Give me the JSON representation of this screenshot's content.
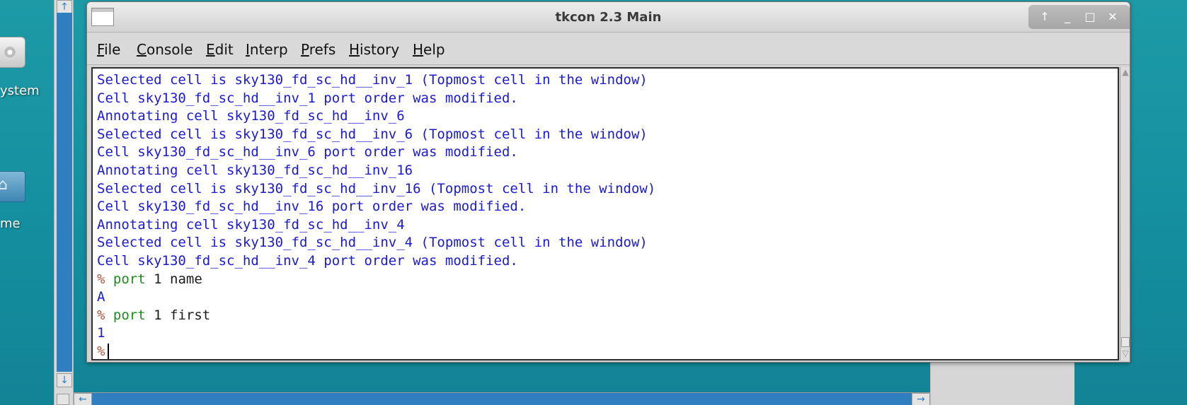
{
  "desktop": {
    "icons": [
      {
        "label": "ystem",
        "icon": "drive-icon"
      },
      {
        "label": "me",
        "icon": "home-folder-icon"
      }
    ]
  },
  "window": {
    "title": "tkcon 2.3 Main",
    "controls": {
      "up": "↑",
      "minimize": "_",
      "maximize": "□",
      "close": "✕"
    },
    "menu": [
      {
        "label": "File",
        "mnemonic": "F",
        "rest": "ile"
      },
      {
        "label": "Console",
        "mnemonic": "C",
        "rest": "onsole"
      },
      {
        "label": "Edit",
        "mnemonic": "E",
        "rest": "dit"
      },
      {
        "label": "Interp",
        "mnemonic": "I",
        "rest": "nterp"
      },
      {
        "label": "Prefs",
        "mnemonic": "P",
        "rest": "refs"
      },
      {
        "label": "History",
        "mnemonic": "H",
        "rest": "istory"
      },
      {
        "label": "Help",
        "mnemonic": "H",
        "rest": "elp"
      }
    ]
  },
  "console": {
    "output_lines": [
      "Selected cell is sky130_fd_sc_hd__inv_1 (Topmost cell in the window)",
      "Cell sky130_fd_sc_hd__inv_1 port order was modified.",
      "Annotating cell sky130_fd_sc_hd__inv_6",
      "Selected cell is sky130_fd_sc_hd__inv_6 (Topmost cell in the window)",
      "Cell sky130_fd_sc_hd__inv_6 port order was modified.",
      "Annotating cell sky130_fd_sc_hd__inv_16",
      "Selected cell is sky130_fd_sc_hd__inv_16 (Topmost cell in the window)",
      "Cell sky130_fd_sc_hd__inv_16 port order was modified.",
      "Annotating cell sky130_fd_sc_hd__inv_4",
      "Selected cell is sky130_fd_sc_hd__inv_4 (Topmost cell in the window)",
      "Cell sky130_fd_sc_hd__inv_4 port order was modified."
    ],
    "prompt": "%",
    "commands": [
      {
        "cmd": "port",
        "args": "1 name",
        "result": "A"
      },
      {
        "cmd": "port",
        "args": "1 first",
        "result": "1"
      }
    ],
    "colors": {
      "output": "#1a1ad4",
      "prompt": "#b5533a",
      "command": "#1f8a1f"
    }
  }
}
